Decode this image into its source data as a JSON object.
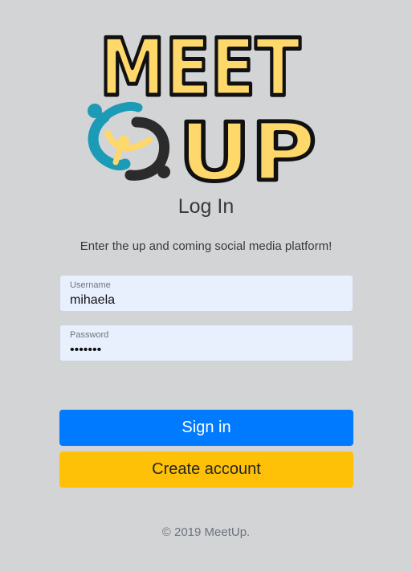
{
  "logo": {
    "line1": "MEET",
    "line2": "UP",
    "colors": {
      "fill": "#ffd86b",
      "outline": "#111111",
      "teal": "#1b9bb5",
      "dark": "#2b2b2b"
    }
  },
  "page": {
    "title": "Log In",
    "subtitle": "Enter the up and coming social media platform!"
  },
  "form": {
    "username": {
      "label": "Username",
      "value": "mihaela"
    },
    "password": {
      "label": "Password",
      "value": "•••••••"
    }
  },
  "buttons": {
    "signin": "Sign in",
    "create": "Create account"
  },
  "footer": {
    "copyright": "© 2019 MeetUp."
  },
  "colors": {
    "primary": "#007bff",
    "warning": "#ffc107",
    "background": "#d3d4d5",
    "input_bg": "#e8f0fe"
  }
}
